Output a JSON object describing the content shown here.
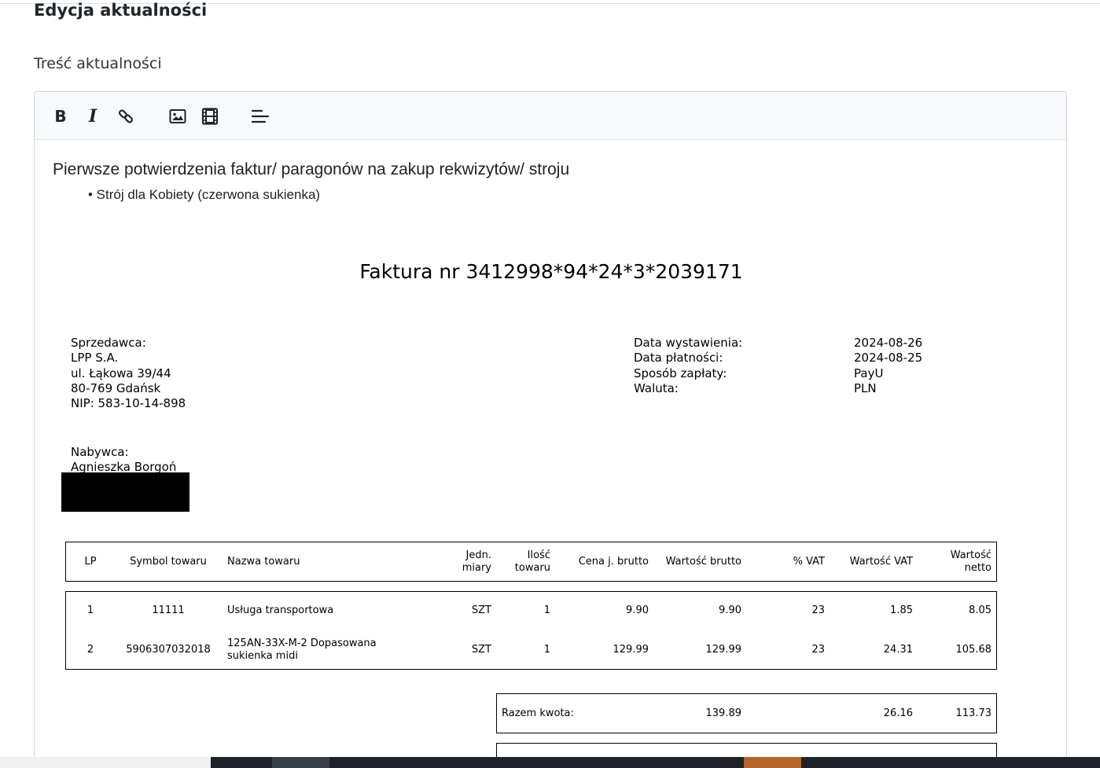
{
  "page": {
    "title": "Edycja aktualności",
    "content_label": "Treść aktualności"
  },
  "toolbar": {
    "bold_glyph": "B",
    "italic_glyph": "I",
    "link_icon": "link-icon",
    "image_icon": "image-icon",
    "video_icon": "film-icon",
    "align_icon": "align-left-icon"
  },
  "content": {
    "heading": "Pierwsze potwierdzenia faktur/ paragonów na zakup rekwizytów/ stroju",
    "bullet": "• Strój dla Kobiety (czerwona sukienka)"
  },
  "invoice": {
    "title": "Faktura nr 3412998*94*24*3*2039171",
    "seller": {
      "label": "Sprzedawca:",
      "name": "LPP S.A.",
      "street": "ul. Łąkowa 39/44",
      "city": "80-769 Gdańsk",
      "nip": "NIP: 583-10-14-898"
    },
    "meta": {
      "issue_label": "Data wystawienia:",
      "issue_value": "2024-08-26",
      "payment_date_label": "Data płatności:",
      "payment_date_value": "2024-08-25",
      "payment_method_label": "Sposób zapłaty:",
      "payment_method_value": "PayU",
      "currency_label": "Waluta:",
      "currency_value": "PLN"
    },
    "buyer": {
      "label": "Nabywca:",
      "name": "Agnieszka Borgoń"
    },
    "columns": {
      "lp": "LP",
      "symbol": "Symbol towaru",
      "name": "Nazwa towaru",
      "unit_1": "Jedn.",
      "unit_2": "miary",
      "qty_1": "Ilość",
      "qty_2": "towaru",
      "unit_price": "Cena j. brutto",
      "gross": "Wartość brutto",
      "vat_pct": "% VAT",
      "vat_value": "Wartość VAT",
      "net_1": "Wartość",
      "net_2": "netto"
    },
    "rows": [
      {
        "lp": "1",
        "symbol": "11111",
        "name_1": "Usługa transportowa",
        "name_2": "",
        "unit": "SZT",
        "qty": "1",
        "unit_price": "9.90",
        "gross": "9.90",
        "vat_pct": "23",
        "vat_value": "1.85",
        "net": "8.05"
      },
      {
        "lp": "2",
        "symbol": "5906307032018",
        "name_1": "125AN-33X-M-2 Dopasowana",
        "name_2": "sukienka midi",
        "unit": "SZT",
        "qty": "1",
        "unit_price": "129.99",
        "gross": "129.99",
        "vat_pct": "23",
        "vat_value": "24.31",
        "net": "105.68"
      }
    ],
    "totals": {
      "label": "Razem kwota:",
      "gross": "139.89",
      "vat": "26.16",
      "net": "113.73"
    }
  }
}
